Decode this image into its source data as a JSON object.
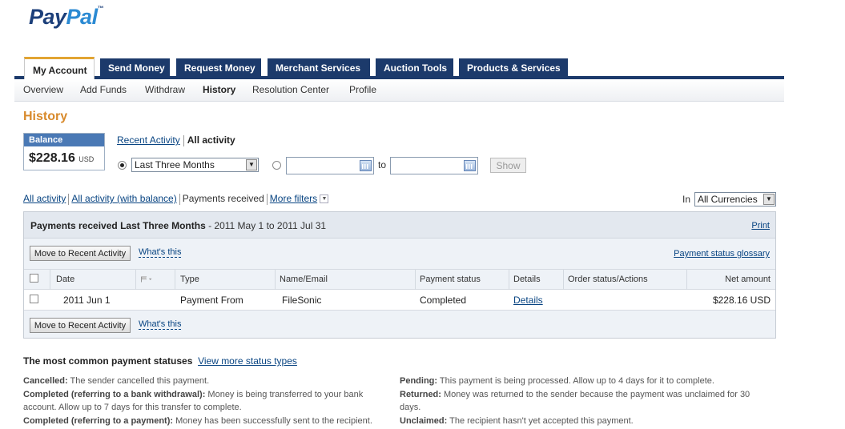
{
  "logo": {
    "pay": "Pay",
    "pal": "Pal",
    "tm": "™"
  },
  "tabs": [
    {
      "label": "My Account",
      "active": true
    },
    {
      "label": "Send Money"
    },
    {
      "label": "Request Money"
    },
    {
      "label": "Merchant Services"
    },
    {
      "label": "Auction Tools"
    },
    {
      "label": "Products & Services"
    }
  ],
  "subnav": [
    "Overview",
    "Add Funds",
    "Withdraw",
    "History",
    "Resolution Center",
    "Profile"
  ],
  "page_title": "History",
  "balance": {
    "label": "Balance",
    "amount": "$228.16",
    "currency": "USD"
  },
  "activity_links": {
    "recent": "Recent Activity",
    "all": "All activity"
  },
  "date_filter": {
    "range_value": "Last Three Months",
    "to_label": "to",
    "from_value": "",
    "to_value": "",
    "show_label": "Show"
  },
  "view_links": {
    "all": "All activity",
    "all_balance": "All activity (with balance)",
    "received": "Payments received",
    "more": "More filters"
  },
  "currency": {
    "label": "In",
    "value": "All Currencies"
  },
  "panel": {
    "title": "Payments received Last Three Months",
    "range": " - 2011 May 1 to 2011 Jul 31",
    "print": "Print",
    "move_button": "Move to Recent Activity",
    "whats_this": "What's this",
    "glossary": "Payment status glossary"
  },
  "table": {
    "columns": [
      "Date",
      "Type",
      "Name/Email",
      "Payment status",
      "Details",
      "Order status/Actions",
      "Net amount"
    ],
    "rows": [
      {
        "date": "2011 Jun 1",
        "type": "Payment From",
        "name": "FileSonic",
        "status": "Completed",
        "details": "Details",
        "order": "",
        "net": "$228.16 USD"
      }
    ]
  },
  "statuses": {
    "title": "The most common payment statuses",
    "more": "View more status types",
    "left": [
      {
        "term": "Cancelled:",
        "desc": " The sender cancelled this payment."
      },
      {
        "term": "Completed (referring to a bank withdrawal):",
        "desc": " Money is being transferred to your bank account. Allow up to 7 days for this transfer to complete."
      },
      {
        "term": "Completed (referring to a payment):",
        "desc": " Money has been successfully sent to the recipient."
      }
    ],
    "right": [
      {
        "term": "Pending:",
        "desc": " This payment is being processed. Allow up to 4 days for it to complete."
      },
      {
        "term": "Returned:",
        "desc": " Money was returned to the sender because the payment was unclaimed for 30 days."
      },
      {
        "term": "Unclaimed:",
        "desc": " The recipient hasn't yet accepted this payment."
      }
    ]
  },
  "colors": {
    "nav": "#1c3a6b",
    "title": "#d88a2c",
    "link": "#084482",
    "balance_header": "#4a79b5"
  }
}
